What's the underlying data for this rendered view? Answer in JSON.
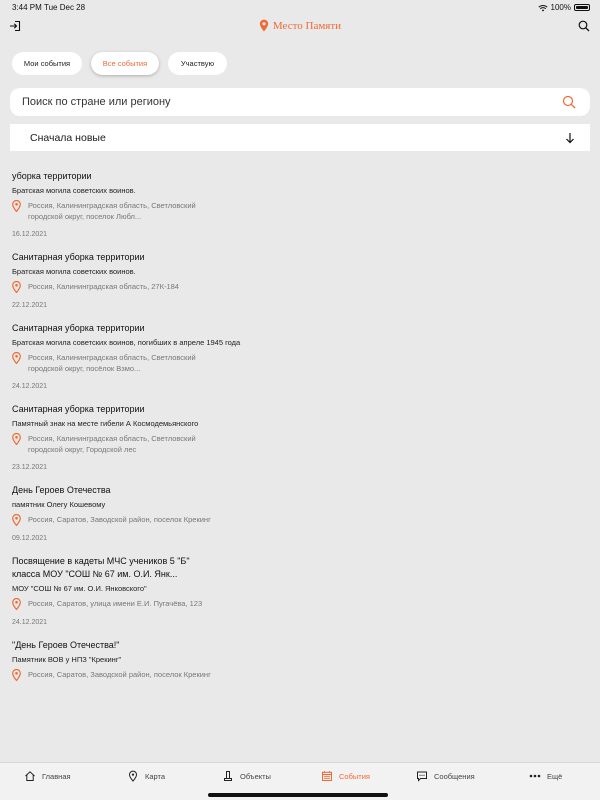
{
  "status": {
    "time": "3:44 PM",
    "date": "Tue Dec 28",
    "battery": "100%"
  },
  "header": {
    "title": "Место Памяти"
  },
  "filters": [
    {
      "label": "Мои события",
      "active": false
    },
    {
      "label": "Все события",
      "active": true
    },
    {
      "label": "Участвую",
      "active": false
    }
  ],
  "search": {
    "placeholder": "Поиск по стране или региону",
    "value": ""
  },
  "sort": {
    "label": "Сначала новые"
  },
  "events": [
    {
      "title": "уборка территории",
      "description": "Братская могила советских воинов.",
      "address": "Россия, Калининградская область, Светловский городской округ, поселок Любл...",
      "date": "16.12.2021"
    },
    {
      "title": "Санитарная уборка территории",
      "description": "Братская могила советских воинов.",
      "address": "Россия, Калининградская область, 27К-184",
      "date": "22.12.2021"
    },
    {
      "title": "Санитарная уборка территории",
      "description": "Братская могила советских воинов, погибших в апреле 1945 года",
      "address": "Россия, Калининградская область, Светловский городской округ, посёлок Взмо...",
      "date": "24.12.2021"
    },
    {
      "title": "Санитарная уборка территории",
      "description": "Памятный знак на месте гибели А Космодемьянского",
      "address": "Россия, Калининградская область, Светловский городской округ, Городской лес",
      "date": "23.12.2021"
    },
    {
      "title": "День Героев Отечества",
      "description": "памятник Олегу Кошевому",
      "address": "Россия, Саратов, Заводской район, поселок Крекинг",
      "date": "09.12.2021"
    },
    {
      "title": "Посвящение в кадеты МЧС учеников 5 \"Б\" класса МОУ \"СОШ № 67 им. О.И. Янк...",
      "description": "МОУ \"СОШ № 67 им. О.И. Янковского\"",
      "address": "Россия, Саратов, улица имени Е.И. Пугачёва, 123",
      "date": "24.12.2021"
    },
    {
      "title": "\"День Героев Отечества!\"",
      "description": "Памятник ВОВ у НПЗ \"Крекинг\"",
      "address": "Россия, Саратов, Заводской район, поселок Крекинг",
      "date": ""
    }
  ],
  "tabs": [
    {
      "label": "Главная",
      "icon": "home-icon",
      "active": false
    },
    {
      "label": "Карта",
      "icon": "map-pin-icon",
      "active": false
    },
    {
      "label": "Объекты",
      "icon": "monument-icon",
      "active": false
    },
    {
      "label": "События",
      "icon": "calendar-icon",
      "active": true
    },
    {
      "label": "Сообщения",
      "icon": "chat-icon",
      "active": false
    },
    {
      "label": "Ещё",
      "icon": "more-icon",
      "active": false
    }
  ],
  "colors": {
    "accent": "#f06a35",
    "background": "#e9e9e9"
  }
}
